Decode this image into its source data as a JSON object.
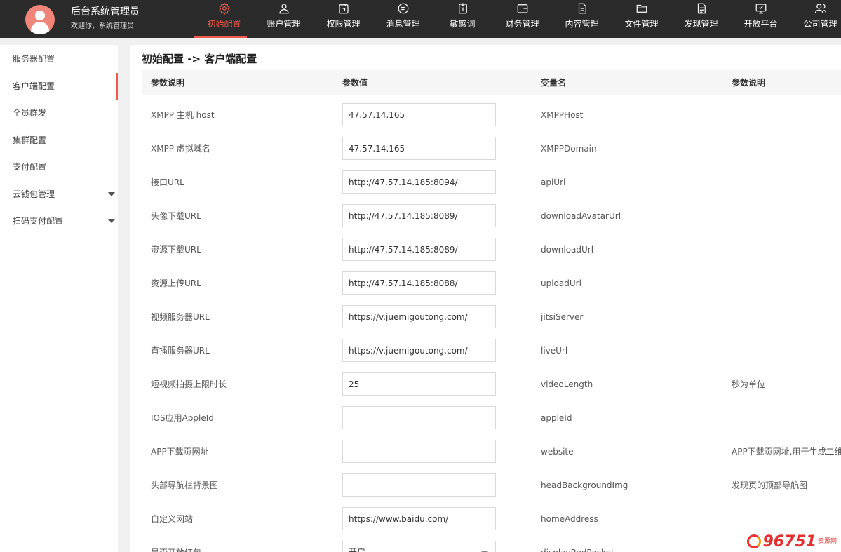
{
  "header": {
    "title": "后台系统管理员",
    "subtitle": "欢迎你，系统管理员"
  },
  "nav": [
    {
      "label": "初始配置",
      "icon": "gear-icon",
      "active": true
    },
    {
      "label": "账户管理",
      "icon": "user-icon"
    },
    {
      "label": "权限管理",
      "icon": "permission-icon"
    },
    {
      "label": "消息管理",
      "icon": "message-icon"
    },
    {
      "label": "敏感词",
      "icon": "clipboard-icon"
    },
    {
      "label": "财务管理",
      "icon": "wallet-icon"
    },
    {
      "label": "内容管理",
      "icon": "document-icon"
    },
    {
      "label": "文件管理",
      "icon": "folder-icon"
    },
    {
      "label": "发现管理",
      "icon": "file-icon"
    },
    {
      "label": "开放平台",
      "icon": "monitor-icon"
    },
    {
      "label": "公司管理",
      "icon": "users-icon"
    }
  ],
  "sidebar": [
    {
      "label": "服务器配置"
    },
    {
      "label": "客户端配置",
      "active": true
    },
    {
      "label": "全员群发"
    },
    {
      "label": "集群配置"
    },
    {
      "label": "支付配置"
    },
    {
      "label": "云钱包管理",
      "expandable": true
    },
    {
      "label": "扫码支付配置",
      "expandable": true
    }
  ],
  "breadcrumb": "初始配置 -> 客户端配置",
  "table": {
    "headers": [
      "参数说明",
      "参数值",
      "变量名",
      "参数说明"
    ],
    "rows": [
      {
        "label": "XMPP 主机 host",
        "value": "47.57.14.165",
        "var": "XMPPHost",
        "desc": ""
      },
      {
        "label": "XMPP 虚拟域名",
        "value": "47.57.14.165",
        "var": "XMPPDomain",
        "desc": ""
      },
      {
        "label": "接口URL",
        "value": "http://47.57.14.185:8094/",
        "var": "apiUrl",
        "desc": ""
      },
      {
        "label": "头像下载URL",
        "value": "http://47.57.14.185:8089/",
        "var": "downloadAvatarUrl",
        "desc": ""
      },
      {
        "label": "资源下载URL",
        "value": "http://47.57.14.185:8089/",
        "var": "downloadUrl",
        "desc": ""
      },
      {
        "label": "资源上传URL",
        "value": "http://47.57.14.185:8088/",
        "var": "uploadUrl",
        "desc": ""
      },
      {
        "label": "视频服务器URL",
        "value": "https://v.juemigoutong.com/",
        "var": "jitsiServer",
        "desc": ""
      },
      {
        "label": "直播服务器URL",
        "value": "https://v.juemigoutong.com/",
        "var": "liveUrl",
        "desc": ""
      },
      {
        "label": "短视频拍摄上限时长",
        "value": "25",
        "var": "videoLength",
        "desc": "秒为单位"
      },
      {
        "label": "IOS应用AppleId",
        "value": "",
        "var": "appleId",
        "desc": ""
      },
      {
        "label": "APP下载页网址",
        "value": "",
        "var": "website",
        "desc": "APP下载页网址,用于生成二维"
      },
      {
        "label": "头部导航栏背景图",
        "value": "",
        "var": "headBackgroundImg",
        "desc": "发现页的顶部导航图"
      },
      {
        "label": "自定义网站",
        "value": "https://www.baidu.com/",
        "var": "homeAddress",
        "desc": ""
      },
      {
        "label": "是否开放红包",
        "value": "开启",
        "var": "displayRedPacket",
        "desc": "",
        "select": true
      }
    ]
  },
  "watermark": {
    "text": "96751",
    "suffix": "资源网"
  },
  "colors": {
    "accent": "#f05a4a",
    "topbar": "#2b2b2b"
  }
}
